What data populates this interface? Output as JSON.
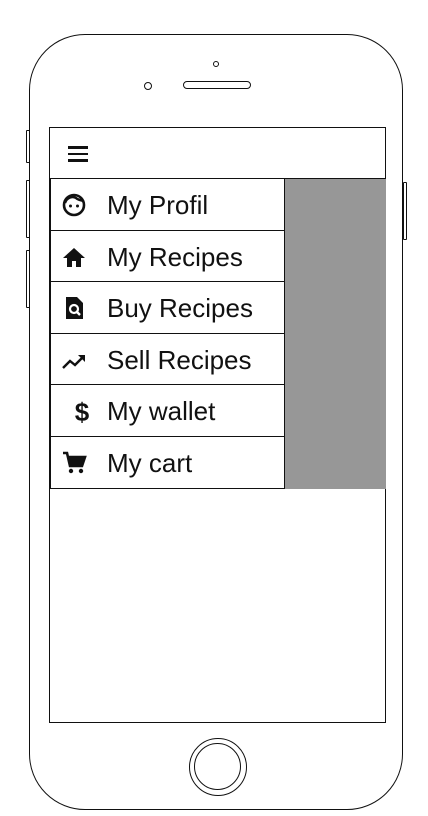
{
  "app": {
    "menu_icon": "hamburger-menu-icon",
    "overlay_color": "#979797"
  },
  "drawer": {
    "items": [
      {
        "label": "My Profil",
        "icon": "face-icon"
      },
      {
        "label": "My Recipes",
        "icon": "home-icon"
      },
      {
        "label": "Buy Recipes",
        "icon": "search-document-icon"
      },
      {
        "label": "Sell Recipes",
        "icon": "trending-up-icon"
      },
      {
        "label": "My wallet",
        "icon": "dollar-icon"
      },
      {
        "label": "My cart",
        "icon": "cart-icon"
      }
    ]
  }
}
